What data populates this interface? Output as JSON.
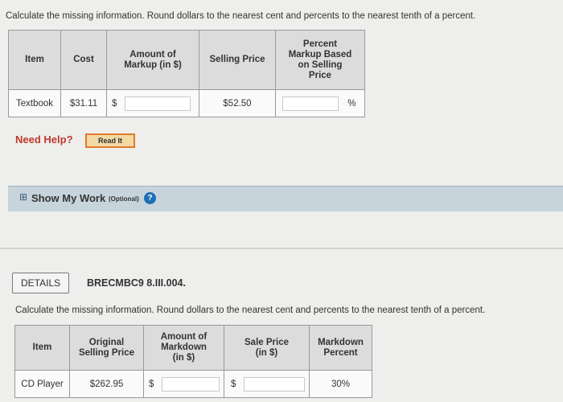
{
  "problem1": {
    "instructions": "Calculate the missing information. Round dollars to the nearest cent and percents to the nearest tenth of a percent.",
    "headers": [
      "Item",
      "Cost",
      "Amount of Markup (in $)",
      "Selling Price",
      "Percent Markup Based on Selling Price"
    ],
    "row": {
      "item": "Textbook",
      "cost": "$31.11",
      "markup_prefix": "$",
      "selling_price": "$52.50",
      "percent_suffix": "%"
    }
  },
  "help": {
    "label": "Need Help?",
    "read_it": "Read It"
  },
  "show_work": {
    "toggle": "⊞",
    "label": "Show My Work",
    "optional": "(Optional)",
    "help_icon": "?"
  },
  "problem2": {
    "details_label": "DETAILS",
    "code": "BRECMBC9 8.III.004.",
    "instructions": "Calculate the missing information. Round dollars to the nearest cent and percents to the nearest tenth of a percent.",
    "headers": [
      "Item",
      "Original Selling Price",
      "Amount of Markdown (in $)",
      "Sale Price (in $)",
      "Markdown Percent"
    ],
    "row": {
      "item": "CD Player",
      "original_price": "$262.95",
      "markdown_prefix": "$",
      "sale_prefix": "$",
      "markdown_percent": "30%"
    }
  },
  "colors": {
    "need_help": "#c0392b",
    "read_it_border": "#e07a2b",
    "read_it_bg": "#f3d9a4",
    "show_work_bar": "#c7d4dc",
    "help_icon": "#1f6fb5"
  }
}
